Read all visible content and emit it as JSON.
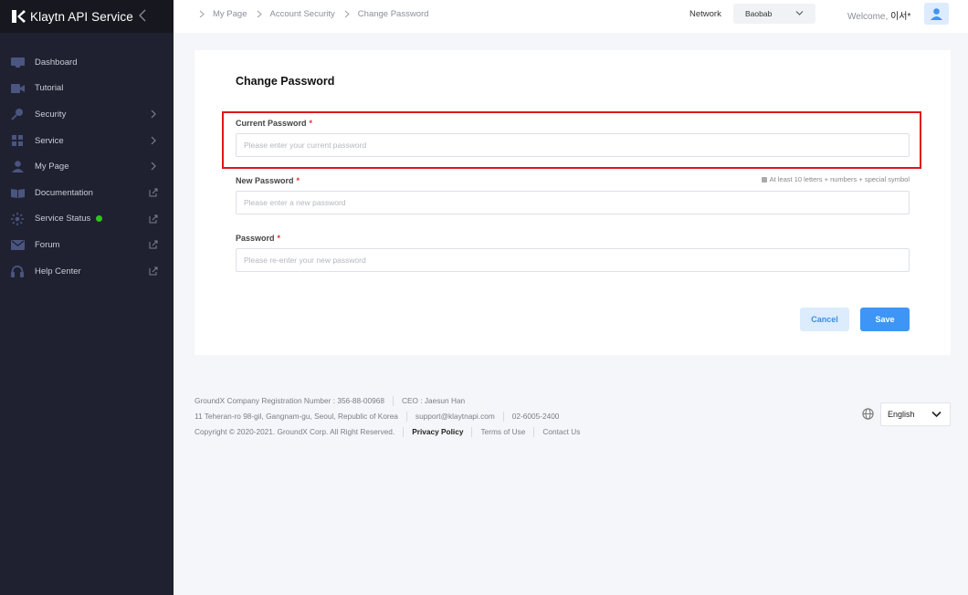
{
  "app": {
    "title": "Klaytn API Service"
  },
  "sidebar": {
    "items": [
      {
        "label": "Dashboard",
        "icon": "dashboard-icon",
        "trailing": "none"
      },
      {
        "label": "Tutorial",
        "icon": "video-icon",
        "trailing": "none"
      },
      {
        "label": "Security",
        "icon": "key-icon",
        "trailing": "chevron-right"
      },
      {
        "label": "Service",
        "icon": "grid-icon",
        "trailing": "chevron-right"
      },
      {
        "label": "My Page",
        "icon": "user-icon",
        "trailing": "chevron-right"
      },
      {
        "label": "Documentation",
        "icon": "book-icon",
        "trailing": "external-link"
      },
      {
        "label": "Service Status",
        "icon": "status-icon",
        "trailing": "external-link",
        "status_color": "#2fc51c"
      },
      {
        "label": "Forum",
        "icon": "mail-icon",
        "trailing": "external-link"
      },
      {
        "label": "Help Center",
        "icon": "headset-icon",
        "trailing": "external-link"
      }
    ]
  },
  "header": {
    "breadcrumb": [
      "My Page",
      "Account Security",
      "Change Password"
    ],
    "network_label": "Network",
    "network_value": "Baobab",
    "welcome_prefix": "Welcome,",
    "username": "이서*"
  },
  "form": {
    "title": "Change Password",
    "fields": [
      {
        "label": "Current Password",
        "required": "*",
        "placeholder": "Please enter your current password",
        "value": ""
      },
      {
        "label": "New Password",
        "required": "*",
        "placeholder": "Please enter a new password",
        "value": ""
      },
      {
        "label": "Password",
        "required": "*",
        "placeholder": "Please re-enter your new password",
        "value": ""
      }
    ],
    "hint": "At least 10 letters + numbers + special symbol",
    "cancel_label": "Cancel",
    "save_label": "Save"
  },
  "footer": {
    "registration": "GroundX Company Registration Number : 356-88-00968",
    "ceo": "CEO : Jaesun Han",
    "address": "11 Teheran-ro 98-gil, Gangnam-gu, Seoul, Republic of Korea",
    "email": "support@klaytnapi.com",
    "phone": "02-6005-2400",
    "copyright": "Copyright © 2020-2021. GroundX Corp. All Right Reserved.",
    "privacy": "Privacy Policy",
    "terms": "Terms of Use",
    "contact": "Contact Us",
    "language": "English"
  },
  "colors": {
    "sidebar_bg": "#1f2130",
    "accent": "#3d95f5",
    "highlight": "#e0161b"
  }
}
